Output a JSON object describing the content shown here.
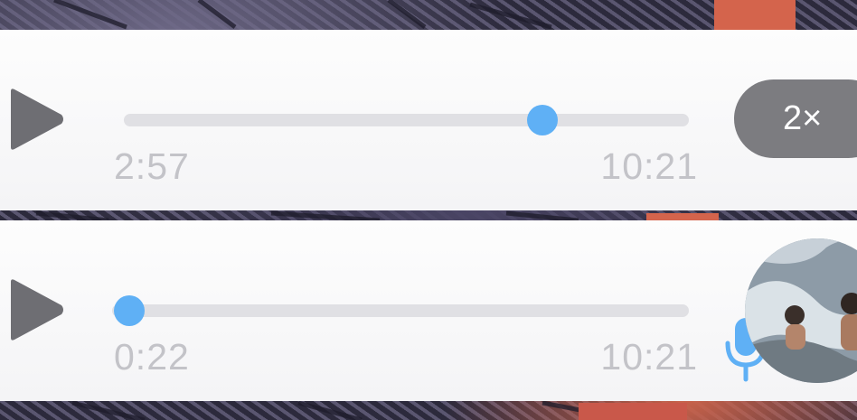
{
  "messages": [
    {
      "elapsed": "2:57",
      "duration": "10:21",
      "progress": 0.74,
      "speed_label": "2×"
    },
    {
      "elapsed": "0:22",
      "duration": "10:21",
      "progress": 0.03
    }
  ],
  "icons": {
    "play": "play-icon",
    "mic": "microphone-icon",
    "avatar": "avatar-photo"
  },
  "colors": {
    "accent": "#5fb0f5",
    "track": "#e0e0e4",
    "time_text": "#c3c3c8",
    "play_icon": "#6e6e73",
    "speed_pill": "#7c7c80"
  }
}
